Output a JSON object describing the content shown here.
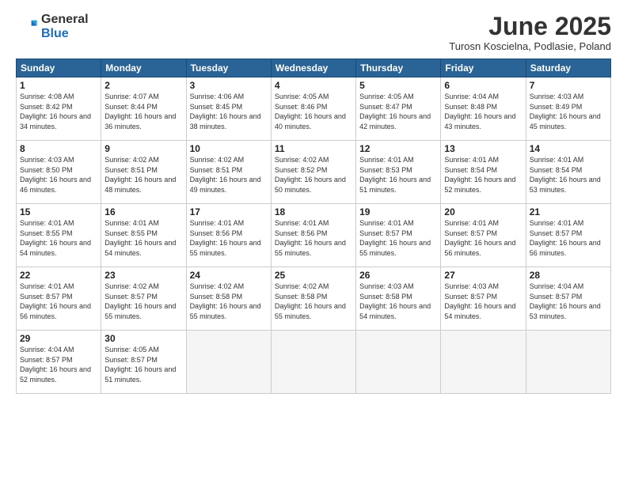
{
  "logo": {
    "general": "General",
    "blue": "Blue"
  },
  "title": "June 2025",
  "location": "Turosn Koscielna, Podlasie, Poland",
  "days_header": [
    "Sunday",
    "Monday",
    "Tuesday",
    "Wednesday",
    "Thursday",
    "Friday",
    "Saturday"
  ],
  "weeks": [
    [
      {
        "num": "1",
        "rise": "4:08 AM",
        "set": "8:42 PM",
        "daylight": "16 hours and 34 minutes."
      },
      {
        "num": "2",
        "rise": "4:07 AM",
        "set": "8:44 PM",
        "daylight": "16 hours and 36 minutes."
      },
      {
        "num": "3",
        "rise": "4:06 AM",
        "set": "8:45 PM",
        "daylight": "16 hours and 38 minutes."
      },
      {
        "num": "4",
        "rise": "4:05 AM",
        "set": "8:46 PM",
        "daylight": "16 hours and 40 minutes."
      },
      {
        "num": "5",
        "rise": "4:05 AM",
        "set": "8:47 PM",
        "daylight": "16 hours and 42 minutes."
      },
      {
        "num": "6",
        "rise": "4:04 AM",
        "set": "8:48 PM",
        "daylight": "16 hours and 43 minutes."
      },
      {
        "num": "7",
        "rise": "4:03 AM",
        "set": "8:49 PM",
        "daylight": "16 hours and 45 minutes."
      }
    ],
    [
      {
        "num": "8",
        "rise": "4:03 AM",
        "set": "8:50 PM",
        "daylight": "16 hours and 46 minutes."
      },
      {
        "num": "9",
        "rise": "4:02 AM",
        "set": "8:51 PM",
        "daylight": "16 hours and 48 minutes."
      },
      {
        "num": "10",
        "rise": "4:02 AM",
        "set": "8:51 PM",
        "daylight": "16 hours and 49 minutes."
      },
      {
        "num": "11",
        "rise": "4:02 AM",
        "set": "8:52 PM",
        "daylight": "16 hours and 50 minutes."
      },
      {
        "num": "12",
        "rise": "4:01 AM",
        "set": "8:53 PM",
        "daylight": "16 hours and 51 minutes."
      },
      {
        "num": "13",
        "rise": "4:01 AM",
        "set": "8:54 PM",
        "daylight": "16 hours and 52 minutes."
      },
      {
        "num": "14",
        "rise": "4:01 AM",
        "set": "8:54 PM",
        "daylight": "16 hours and 53 minutes."
      }
    ],
    [
      {
        "num": "15",
        "rise": "4:01 AM",
        "set": "8:55 PM",
        "daylight": "16 hours and 54 minutes."
      },
      {
        "num": "16",
        "rise": "4:01 AM",
        "set": "8:55 PM",
        "daylight": "16 hours and 54 minutes."
      },
      {
        "num": "17",
        "rise": "4:01 AM",
        "set": "8:56 PM",
        "daylight": "16 hours and 55 minutes."
      },
      {
        "num": "18",
        "rise": "4:01 AM",
        "set": "8:56 PM",
        "daylight": "16 hours and 55 minutes."
      },
      {
        "num": "19",
        "rise": "4:01 AM",
        "set": "8:57 PM",
        "daylight": "16 hours and 55 minutes."
      },
      {
        "num": "20",
        "rise": "4:01 AM",
        "set": "8:57 PM",
        "daylight": "16 hours and 56 minutes."
      },
      {
        "num": "21",
        "rise": "4:01 AM",
        "set": "8:57 PM",
        "daylight": "16 hours and 56 minutes."
      }
    ],
    [
      {
        "num": "22",
        "rise": "4:01 AM",
        "set": "8:57 PM",
        "daylight": "16 hours and 56 minutes."
      },
      {
        "num": "23",
        "rise": "4:02 AM",
        "set": "8:57 PM",
        "daylight": "16 hours and 55 minutes."
      },
      {
        "num": "24",
        "rise": "4:02 AM",
        "set": "8:58 PM",
        "daylight": "16 hours and 55 minutes."
      },
      {
        "num": "25",
        "rise": "4:02 AM",
        "set": "8:58 PM",
        "daylight": "16 hours and 55 minutes."
      },
      {
        "num": "26",
        "rise": "4:03 AM",
        "set": "8:58 PM",
        "daylight": "16 hours and 54 minutes."
      },
      {
        "num": "27",
        "rise": "4:03 AM",
        "set": "8:57 PM",
        "daylight": "16 hours and 54 minutes."
      },
      {
        "num": "28",
        "rise": "4:04 AM",
        "set": "8:57 PM",
        "daylight": "16 hours and 53 minutes."
      }
    ],
    [
      {
        "num": "29",
        "rise": "4:04 AM",
        "set": "8:57 PM",
        "daylight": "16 hours and 52 minutes."
      },
      {
        "num": "30",
        "rise": "4:05 AM",
        "set": "8:57 PM",
        "daylight": "16 hours and 51 minutes."
      },
      null,
      null,
      null,
      null,
      null
    ]
  ]
}
